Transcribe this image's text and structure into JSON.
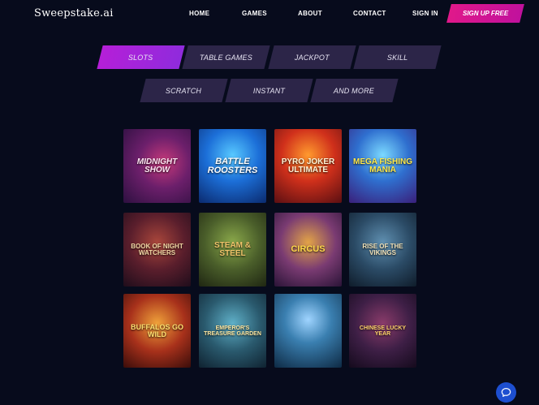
{
  "header": {
    "logo": "Sweepstake.ai",
    "nav": [
      "HOME",
      "GAMES",
      "ABOUT",
      "CONTACT",
      "SIGN IN"
    ],
    "signup_label": "SIGN UP FREE"
  },
  "categories": [
    "SLOTS",
    "TABLE GAMES",
    "JACKPOT",
    "SKILL",
    "SCRATCH",
    "INSTANT",
    "AND MORE"
  ],
  "active_category": "SLOTS",
  "games": [
    {
      "title": "MIDNIGHT SHOW"
    },
    {
      "title": "BATTLE ROOSTERS"
    },
    {
      "title": "PYRO JOKER ULTIMATE"
    },
    {
      "title": "MEGA FISHING MANIA"
    },
    {
      "title": "BOOK OF NIGHT WATCHERS"
    },
    {
      "title": "STEAM & STEEL"
    },
    {
      "title": "CIRCUS"
    },
    {
      "title": "RISE OF THE VIKINGS"
    },
    {
      "title": "BUFFALOS GO WILD"
    },
    {
      "title": "EMPEROR'S TREASURE GARDEN"
    },
    {
      "title": "CHINESE LUCKY YEAR"
    },
    {
      "title": ""
    }
  ],
  "colors": {
    "background": "#070b1c",
    "accent_pink": "#e0188a",
    "accent_purple": "#b51fd8",
    "tab_bg": "#2c2548",
    "chat_blue": "#1d4fd0"
  },
  "chat": {
    "icon": "chat-bubble-icon"
  }
}
